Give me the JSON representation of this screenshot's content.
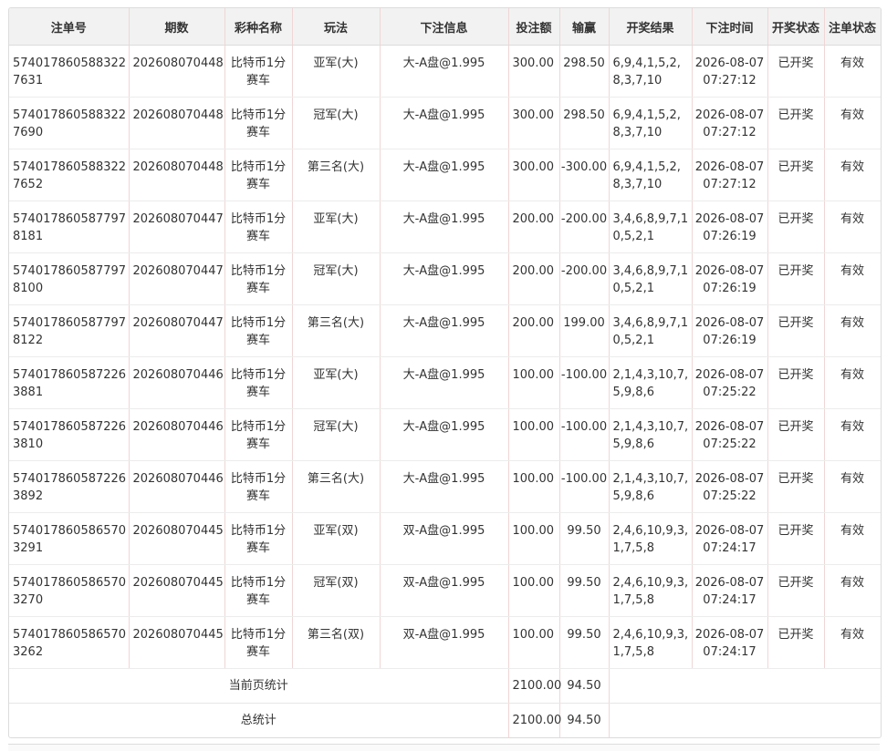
{
  "columns": [
    "注单号",
    "期数",
    "彩种名称",
    "玩法",
    "下注信息",
    "投注额",
    "输赢",
    "开奖结果",
    "下注时间",
    "开奖状态",
    "注单状态"
  ],
  "rows": [
    {
      "id": "5740178605883227631",
      "period": "202608070448",
      "lottery": "比特币1分赛车",
      "play": "亚军(大)",
      "bet": "大-A盘@1.995",
      "amount": "300.00",
      "win": "298.50",
      "result": "6,9,4,1,5,2,8,3,7,10",
      "time_date": "2026-08-07",
      "time_clock": "07:27:12",
      "draw_status": "已开奖",
      "order_status": "有效"
    },
    {
      "id": "5740178605883227690",
      "period": "202608070448",
      "lottery": "比特币1分赛车",
      "play": "冠军(大)",
      "bet": "大-A盘@1.995",
      "amount": "300.00",
      "win": "298.50",
      "result": "6,9,4,1,5,2,8,3,7,10",
      "time_date": "2026-08-07",
      "time_clock": "07:27:12",
      "draw_status": "已开奖",
      "order_status": "有效"
    },
    {
      "id": "5740178605883227652",
      "period": "202608070448",
      "lottery": "比特币1分赛车",
      "play": "第三名(大)",
      "bet": "大-A盘@1.995",
      "amount": "300.00",
      "win": "-300.00",
      "result": "6,9,4,1,5,2,8,3,7,10",
      "time_date": "2026-08-07",
      "time_clock": "07:27:12",
      "draw_status": "已开奖",
      "order_status": "有效"
    },
    {
      "id": "5740178605877978181",
      "period": "202608070447",
      "lottery": "比特币1分赛车",
      "play": "亚军(大)",
      "bet": "大-A盘@1.995",
      "amount": "200.00",
      "win": "-200.00",
      "result": "3,4,6,8,9,7,10,5,2,1",
      "time_date": "2026-08-07",
      "time_clock": "07:26:19",
      "draw_status": "已开奖",
      "order_status": "有效"
    },
    {
      "id": "5740178605877978100",
      "period": "202608070447",
      "lottery": "比特币1分赛车",
      "play": "冠军(大)",
      "bet": "大-A盘@1.995",
      "amount": "200.00",
      "win": "-200.00",
      "result": "3,4,6,8,9,7,10,5,2,1",
      "time_date": "2026-08-07",
      "time_clock": "07:26:19",
      "draw_status": "已开奖",
      "order_status": "有效"
    },
    {
      "id": "5740178605877978122",
      "period": "202608070447",
      "lottery": "比特币1分赛车",
      "play": "第三名(大)",
      "bet": "大-A盘@1.995",
      "amount": "200.00",
      "win": "199.00",
      "result": "3,4,6,8,9,7,10,5,2,1",
      "time_date": "2026-08-07",
      "time_clock": "07:26:19",
      "draw_status": "已开奖",
      "order_status": "有效"
    },
    {
      "id": "5740178605872263881",
      "period": "202608070446",
      "lottery": "比特币1分赛车",
      "play": "亚军(大)",
      "bet": "大-A盘@1.995",
      "amount": "100.00",
      "win": "-100.00",
      "result": "2,1,4,3,10,7,5,9,8,6",
      "time_date": "2026-08-07",
      "time_clock": "07:25:22",
      "draw_status": "已开奖",
      "order_status": "有效"
    },
    {
      "id": "5740178605872263810",
      "period": "202608070446",
      "lottery": "比特币1分赛车",
      "play": "冠军(大)",
      "bet": "大-A盘@1.995",
      "amount": "100.00",
      "win": "-100.00",
      "result": "2,1,4,3,10,7,5,9,8,6",
      "time_date": "2026-08-07",
      "time_clock": "07:25:22",
      "draw_status": "已开奖",
      "order_status": "有效"
    },
    {
      "id": "5740178605872263892",
      "period": "202608070446",
      "lottery": "比特币1分赛车",
      "play": "第三名(大)",
      "bet": "大-A盘@1.995",
      "amount": "100.00",
      "win": "-100.00",
      "result": "2,1,4,3,10,7,5,9,8,6",
      "time_date": "2026-08-07",
      "time_clock": "07:25:22",
      "draw_status": "已开奖",
      "order_status": "有效"
    },
    {
      "id": "5740178605865703291",
      "period": "202608070445",
      "lottery": "比特币1分赛车",
      "play": "亚军(双)",
      "bet": "双-A盘@1.995",
      "amount": "100.00",
      "win": "99.50",
      "result": "2,4,6,10,9,3,1,7,5,8",
      "time_date": "2026-08-07",
      "time_clock": "07:24:17",
      "draw_status": "已开奖",
      "order_status": "有效"
    },
    {
      "id": "5740178605865703270",
      "period": "202608070445",
      "lottery": "比特币1分赛车",
      "play": "冠军(双)",
      "bet": "双-A盘@1.995",
      "amount": "100.00",
      "win": "99.50",
      "result": "2,4,6,10,9,3,1,7,5,8",
      "time_date": "2026-08-07",
      "time_clock": "07:24:17",
      "draw_status": "已开奖",
      "order_status": "有效"
    },
    {
      "id": "5740178605865703262",
      "period": "202608070445",
      "lottery": "比特币1分赛车",
      "play": "第三名(双)",
      "bet": "双-A盘@1.995",
      "amount": "100.00",
      "win": "99.50",
      "result": "2,4,6,10,9,3,1,7,5,8",
      "time_date": "2026-08-07",
      "time_clock": "07:24:17",
      "draw_status": "已开奖",
      "order_status": "有效"
    }
  ],
  "summary": {
    "page_label": "当前页统计",
    "page_amount": "2100.00",
    "page_win": "94.50",
    "total_label": "总统计",
    "total_amount": "2100.00",
    "total_win": "94.50"
  }
}
